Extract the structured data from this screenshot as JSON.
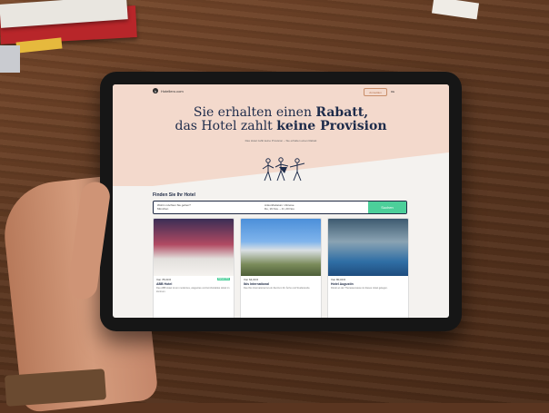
{
  "site": {
    "brand": "Hotellero.com",
    "nav_button": "Anmelden",
    "flag_label": "DE"
  },
  "hero": {
    "headline_line1_pre": "Sie erhalten einen ",
    "headline_line1_bold": "Rabatt,",
    "headline_line2_pre": "das Hotel zahlt ",
    "headline_line2_bold": "keine Provision",
    "subtext": "Das Hotel zahlt keine Provision – Sie erhalten einen Rabatt"
  },
  "search": {
    "heading": "Finden Sie Ihr Hotel",
    "destination_label": "Wohin möchten Sie gehen?",
    "destination_value": "München",
    "dates_label": "Ankunftsdatum / Abreise",
    "dates_value": "Do, 16 Nov. – Fr, 20 Nov.",
    "button": "Suchen"
  },
  "cards": [
    {
      "price": "Von 78,00 €",
      "title": "ABB Hotel",
      "desc": "Das ABB Hotel ist ein modernes, elegantes und komfortables Hotel im Zentrum.",
      "tag": "Rabatt 9%"
    },
    {
      "price": "Von 64,00 €",
      "title": "Ibis International",
      "desc": "Das Ibis International ist ein Zentrum für Ärzte und Studierende.",
      "tag": ""
    },
    {
      "price": "Von 80,00 €",
      "title": "Hotel Augustin",
      "desc": "Direkt an der Theresienwiese ist dieses Hotel gelegen.",
      "tag": ""
    }
  ]
}
